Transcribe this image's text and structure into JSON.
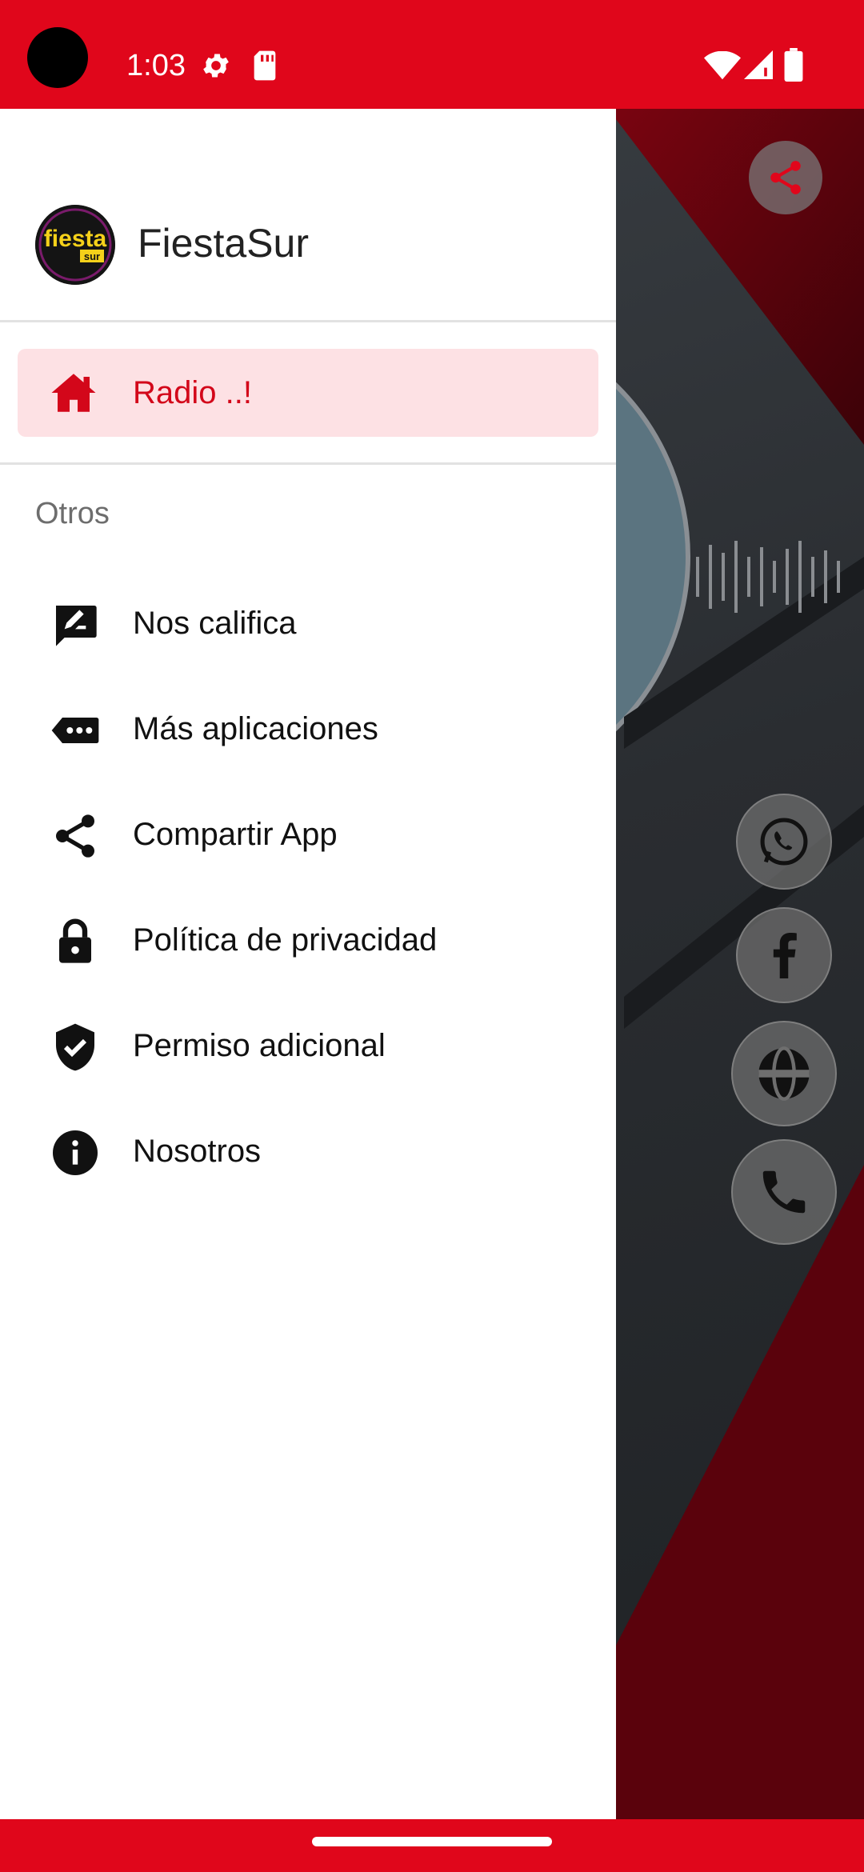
{
  "status_bar": {
    "time": "1:03",
    "icons": [
      "settings-icon",
      "sd-card-icon",
      "wifi-icon",
      "signal-icon",
      "battery-icon"
    ]
  },
  "background": {
    "share_icon": "share-icon",
    "fab_buttons": [
      "whatsapp-icon",
      "facebook-icon",
      "globe-icon",
      "phone-icon"
    ]
  },
  "drawer": {
    "app_name": "FiestaSur",
    "logo_text": "fiesta",
    "logo_subtext": "sur",
    "active_item": {
      "label": "Radio ..!",
      "icon": "home-icon"
    },
    "section_title": "Otros",
    "items": [
      {
        "label": "Nos califica",
        "icon": "rate-review-icon"
      },
      {
        "label": "Más aplicaciones",
        "icon": "more-apps-icon"
      },
      {
        "label": "Compartir App",
        "icon": "share-icon"
      },
      {
        "label": "Política de privacidad",
        "icon": "lock-icon"
      },
      {
        "label": "Permiso adicional",
        "icon": "verified-shield-icon"
      },
      {
        "label": "Nosotros",
        "icon": "info-icon"
      }
    ]
  },
  "colors": {
    "brand_red": "#e0061b",
    "active_bg": "#fde1e4",
    "active_text": "#d3071a"
  }
}
